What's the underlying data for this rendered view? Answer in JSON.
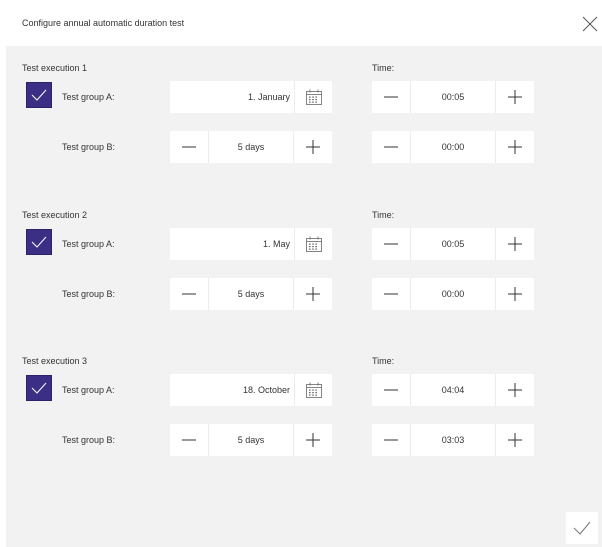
{
  "dialog": {
    "title": "Configure annual automatic duration test"
  },
  "labels": {
    "time": "Time:",
    "group_a": "Test group A:",
    "group_b": "Test group B:"
  },
  "executions": [
    {
      "label": "Test execution 1",
      "group_a_checked": true,
      "group_a_date": "1. January",
      "group_a_time": "00:05",
      "group_b_duration": "5 days",
      "group_b_time": "00:00"
    },
    {
      "label": "Test execution 2",
      "group_a_checked": true,
      "group_a_date": "1. May",
      "group_a_time": "00:05",
      "group_b_duration": "5 days",
      "group_b_time": "00:00"
    },
    {
      "label": "Test execution 3",
      "group_a_checked": true,
      "group_a_date": "18. October",
      "group_a_time": "04:04",
      "group_b_duration": "5 days",
      "group_b_time": "03:03"
    }
  ],
  "colors": {
    "checkbox_fill": "#3a2f85",
    "panel_background": "#f2f2f2"
  }
}
